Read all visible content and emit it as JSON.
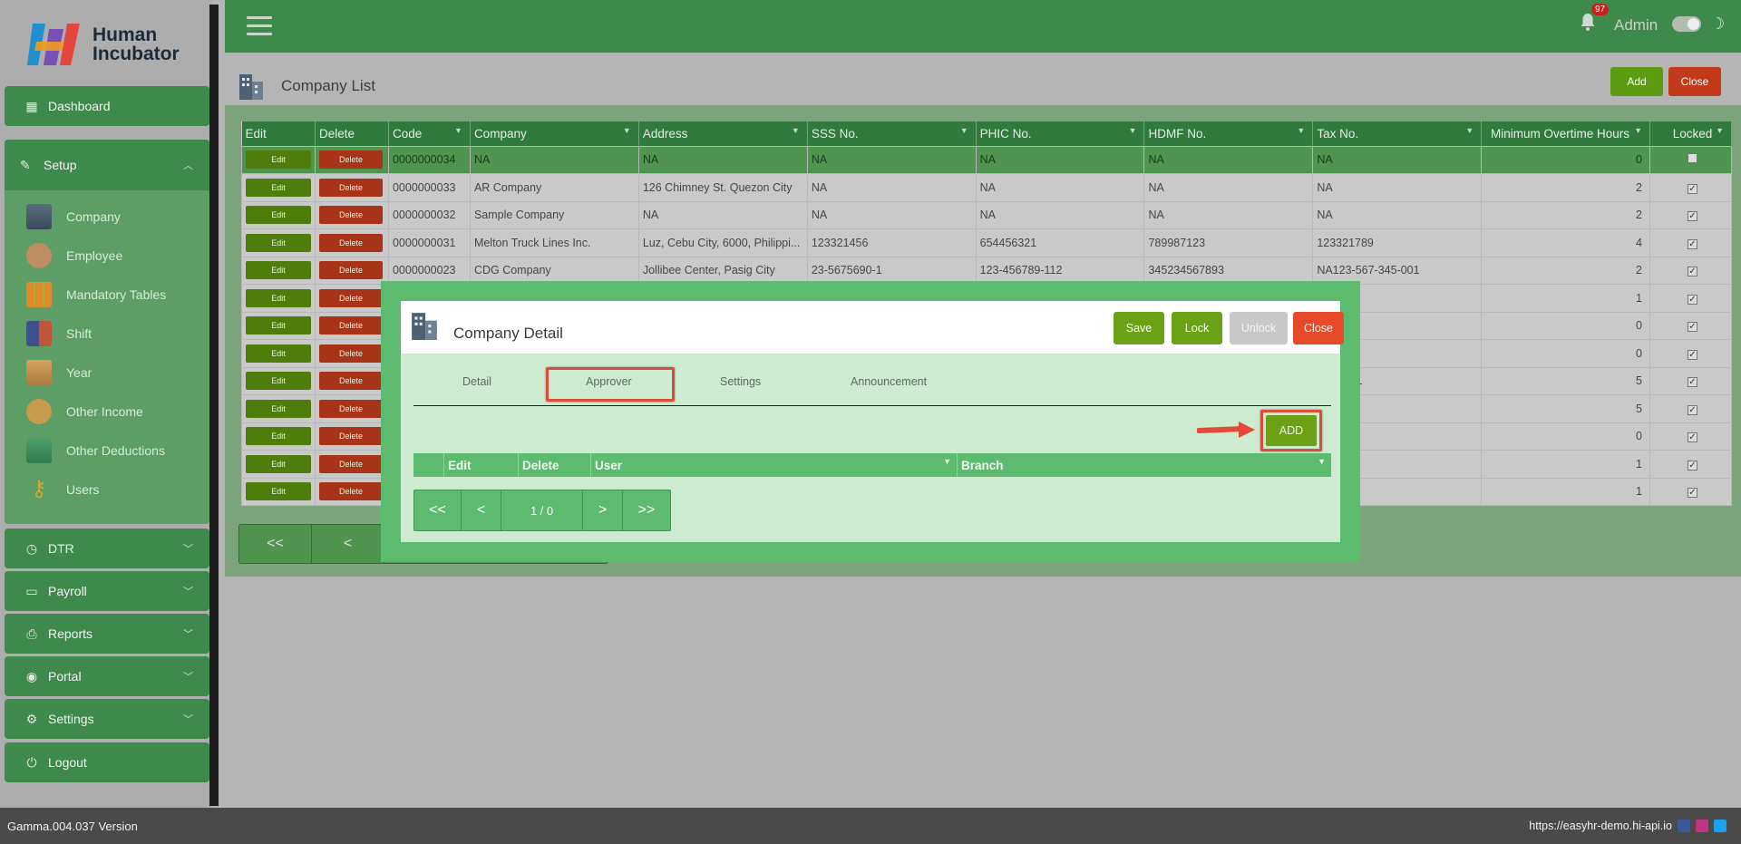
{
  "app": {
    "brand_line1": "Human",
    "brand_line2": "Incubator"
  },
  "sidebar": {
    "dashboard": "Dashboard",
    "setup": "Setup",
    "setup_items": [
      "Company",
      "Employee",
      "Mandatory Tables",
      "Shift",
      "Year",
      "Other Income",
      "Other Deductions",
      "Users"
    ],
    "sections": [
      "DTR",
      "Payroll",
      "Reports",
      "Portal",
      "Settings"
    ],
    "logout": "Logout"
  },
  "topbar": {
    "notification_count": "97",
    "user": "Admin"
  },
  "page": {
    "title": "Company List",
    "add": "Add",
    "close": "Close"
  },
  "table": {
    "columns": [
      "Edit",
      "Delete",
      "Code",
      "Company",
      "Address",
      "SSS No.",
      "PHIC No.",
      "HDMF No.",
      "Tax No.",
      "Minimum Overtime Hours",
      "Locked"
    ],
    "edit_label": "Edit",
    "delete_label": "Delete",
    "rows": [
      {
        "code": "0000000034",
        "company": "NA",
        "address": "NA",
        "sss": "NA",
        "phic": "NA",
        "hdmf": "NA",
        "tax": "NA",
        "ot": "0",
        "locked": false
      },
      {
        "code": "0000000033",
        "company": "AR Company",
        "address": "126 Chimney St. Quezon City",
        "sss": "NA",
        "phic": "NA",
        "hdmf": "NA",
        "tax": "NA",
        "ot": "2",
        "locked": true
      },
      {
        "code": "0000000032",
        "company": "Sample Company",
        "address": "NA",
        "sss": "NA",
        "phic": "NA",
        "hdmf": "NA",
        "tax": "NA",
        "ot": "2",
        "locked": true
      },
      {
        "code": "0000000031",
        "company": "Melton Truck Lines Inc.",
        "address": "Luz, Cebu City, 6000, Philippi...",
        "sss": "123321456",
        "phic": "654456321",
        "hdmf": "789987123",
        "tax": "123321789",
        "ot": "4",
        "locked": true
      },
      {
        "code": "0000000023",
        "company": "CDG Company",
        "address": "Jollibee Center, Pasig City",
        "sss": "23-5675690-1",
        "phic": "123-456789-112",
        "hdmf": "345234567893",
        "tax": "NA123-567-345-001",
        "ot": "2",
        "locked": true
      },
      {
        "code": "",
        "company": "",
        "address": "",
        "sss": "",
        "phic": "",
        "hdmf": "",
        "tax": "",
        "ot": "1",
        "locked": true
      },
      {
        "code": "",
        "company": "",
        "address": "",
        "sss": "",
        "phic": "",
        "hdmf": "",
        "tax": "3",
        "ot": "0",
        "locked": true
      },
      {
        "code": "",
        "company": "",
        "address": "",
        "sss": "",
        "phic": "",
        "hdmf": "",
        "tax": "4",
        "ot": "0",
        "locked": true
      },
      {
        "code": "",
        "company": "",
        "address": "",
        "sss": "",
        "phic": "",
        "hdmf": "",
        "tax": "-789-001",
        "ot": "5",
        "locked": true
      },
      {
        "code": "",
        "company": "",
        "address": "",
        "sss": "",
        "phic": "",
        "hdmf": "",
        "tax": "",
        "ot": "5",
        "locked": true
      },
      {
        "code": "",
        "company": "",
        "address": "",
        "sss": "",
        "phic": "",
        "hdmf": "",
        "tax": "4",
        "ot": "0",
        "locked": true
      },
      {
        "code": "",
        "company": "",
        "address": "",
        "sss": "",
        "phic": "",
        "hdmf": "",
        "tax": "",
        "ot": "1",
        "locked": true
      },
      {
        "code": "",
        "company": "",
        "address": "",
        "sss": "",
        "phic": "",
        "hdmf": "",
        "tax": "89",
        "ot": "1",
        "locked": true
      }
    ]
  },
  "bg_pager": {
    "first": "<<",
    "prev": "<"
  },
  "modal": {
    "title": "Company Detail",
    "save": "Save",
    "lock": "Lock",
    "unlock": "Unlock",
    "close": "Close",
    "tabs": [
      "Detail",
      "Approver",
      "Settings",
      "Announcement"
    ],
    "add": "ADD",
    "columns": [
      "Edit",
      "Delete",
      "User",
      "Branch"
    ],
    "pager": {
      "first": "<<",
      "prev": "<",
      "info": "1 / 0",
      "next": ">",
      "last": ">>"
    }
  },
  "footer": {
    "version": "Gamma.004.037 Version",
    "url": "https://easyhr-demo.hi-api.io"
  },
  "colors": {
    "primary": "#3e8a4c",
    "modal_green": "#5cbb6e",
    "action_green": "#6aa115",
    "danger": "#c23a1a",
    "highlight": "#dd4b3a"
  }
}
